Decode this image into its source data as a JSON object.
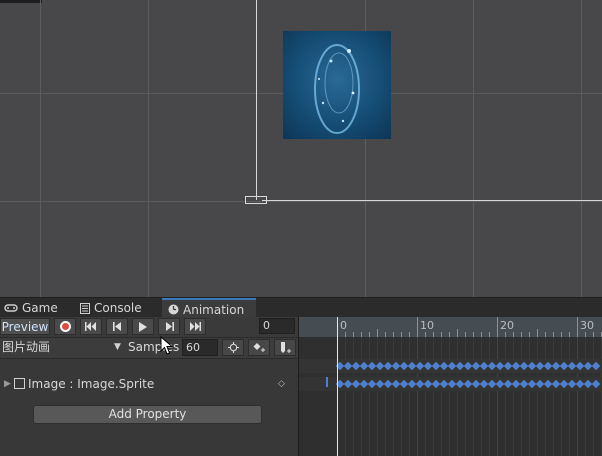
{
  "tabs": [
    {
      "label": "Game",
      "icon": "gamepad-icon"
    },
    {
      "label": "Console",
      "icon": "console-icon"
    },
    {
      "label": "Animation",
      "icon": "clock-icon",
      "active": true
    }
  ],
  "toolbar": {
    "preview_label": "Preview",
    "record_icon": "record-icon",
    "first_key_icon": "first-key-icon",
    "prev_key_icon": "prev-key-icon",
    "play_icon": "play-icon",
    "next_key_icon": "next-key-icon",
    "last_key_icon": "last-key-icon",
    "frame_value": "0"
  },
  "clip": {
    "name": "图片动画",
    "samples_label": "Samples",
    "samples_value": "60"
  },
  "property": {
    "label": "Image : Image.Sprite"
  },
  "add_property_label": "Add Property",
  "timeline": {
    "ruler_labels": [
      "0",
      "10",
      "20",
      "30"
    ]
  },
  "colors": {
    "accent": "#3a79bb",
    "keyframe": "#4f7fce",
    "record": "#e04a3d"
  }
}
